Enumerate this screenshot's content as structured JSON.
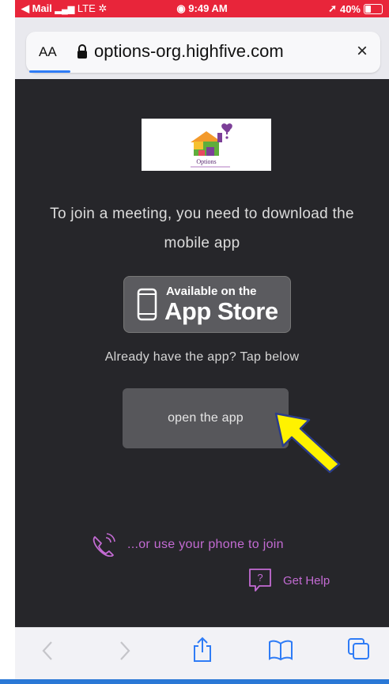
{
  "status_bar": {
    "back_label": "◀ Mail",
    "network": "LTE",
    "time": "9:49 AM",
    "battery": "40%",
    "battery_level": 0.4
  },
  "address_bar": {
    "reader_label": "AA",
    "url": "options-org.highfive.com",
    "close_glyph": "×"
  },
  "logo": {
    "text": "Options"
  },
  "content": {
    "message_line1": "To join a meeting, you need to download the",
    "message_line2": "mobile app",
    "app_store_line1": "Available on the",
    "app_store_line2": "App Store",
    "already_text": "Already have the app? Tap below",
    "open_app_label": "open the app",
    "phone_join_label": "...or use your phone to join",
    "help_label": "Get Help",
    "help_glyph": "?"
  },
  "colors": {
    "status_bar": "#e8253a",
    "background": "#26262a",
    "link": "#c36bd3",
    "arrow": "#fff200"
  }
}
